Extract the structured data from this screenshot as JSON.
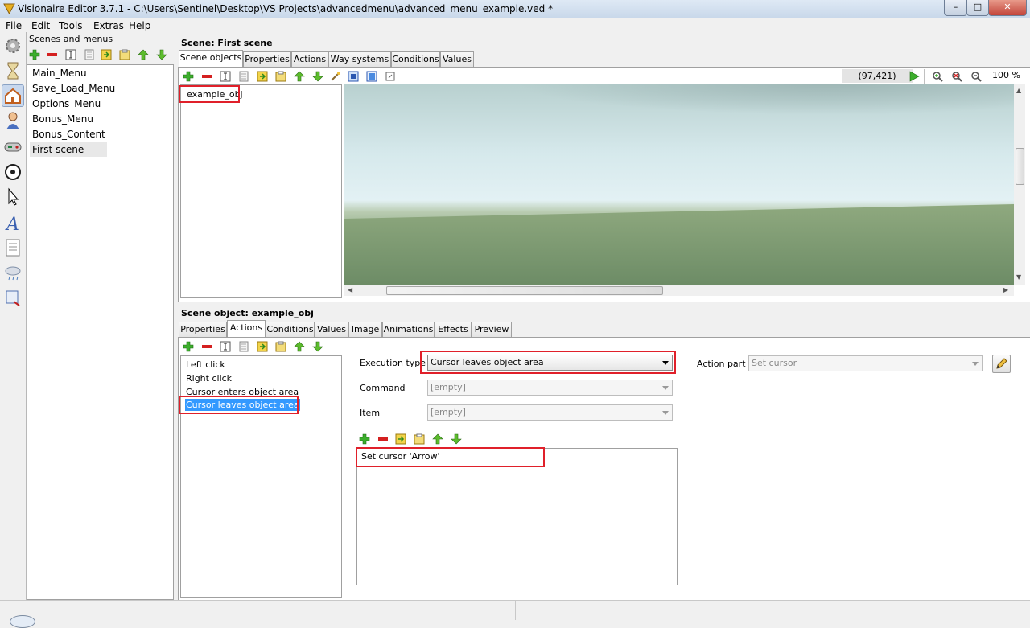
{
  "window": {
    "title": "Visionaire Editor 3.7.1 - C:\\Users\\Sentinel\\Desktop\\VS Projects\\advancedmenu\\advanced_menu_example.ved *",
    "minimize": "–",
    "maximize": "□",
    "close": "✕"
  },
  "menu": {
    "items": [
      "File",
      "Edit",
      "Tools",
      "Extras",
      "Help"
    ]
  },
  "sidebar_icons": [
    "gear-icon",
    "hourglass-icon",
    "home-icon",
    "character-icon",
    "gamepad-icon",
    "ball-icon",
    "cursor-icon",
    "font-icon",
    "text-icon",
    "weather-icon",
    "script-icon"
  ],
  "scenes_panel": {
    "title": "Scenes and menus",
    "items": [
      "Main_Menu",
      "Save_Load_Menu",
      "Options_Menu",
      "Bonus_Menu",
      "Bonus_Content",
      "First scene"
    ],
    "selected": "First scene"
  },
  "scene_panel": {
    "title": "Scene: First scene",
    "tabs": [
      "Scene objects",
      "Properties",
      "Actions",
      "Way systems",
      "Conditions",
      "Values"
    ],
    "active_tab": "Scene objects",
    "objects": [
      "example_obj"
    ],
    "coords": "(97,421)",
    "zoom": "100 %"
  },
  "object_panel": {
    "title": "Scene object: example_obj",
    "tabs": [
      "Properties",
      "Actions",
      "Conditions",
      "Values",
      "Image",
      "Animations",
      "Effects",
      "Preview"
    ],
    "active_tab": "Actions",
    "actions": [
      "Left click",
      "Right click",
      "Cursor enters object area",
      "Cursor leaves object area"
    ],
    "selected_action": "Cursor leaves object area",
    "execution_type_label": "Execution type",
    "execution_type_value": "Cursor leaves object area",
    "command_label": "Command",
    "command_value": "[empty]",
    "item_label": "Item",
    "item_value": "[empty]",
    "action_part_label": "Action part",
    "action_part_value": "Set cursor",
    "action_parts": [
      "Set cursor 'Arrow'"
    ]
  },
  "colors": {
    "highlight": "#e0202a",
    "selection": "#3399ff"
  }
}
